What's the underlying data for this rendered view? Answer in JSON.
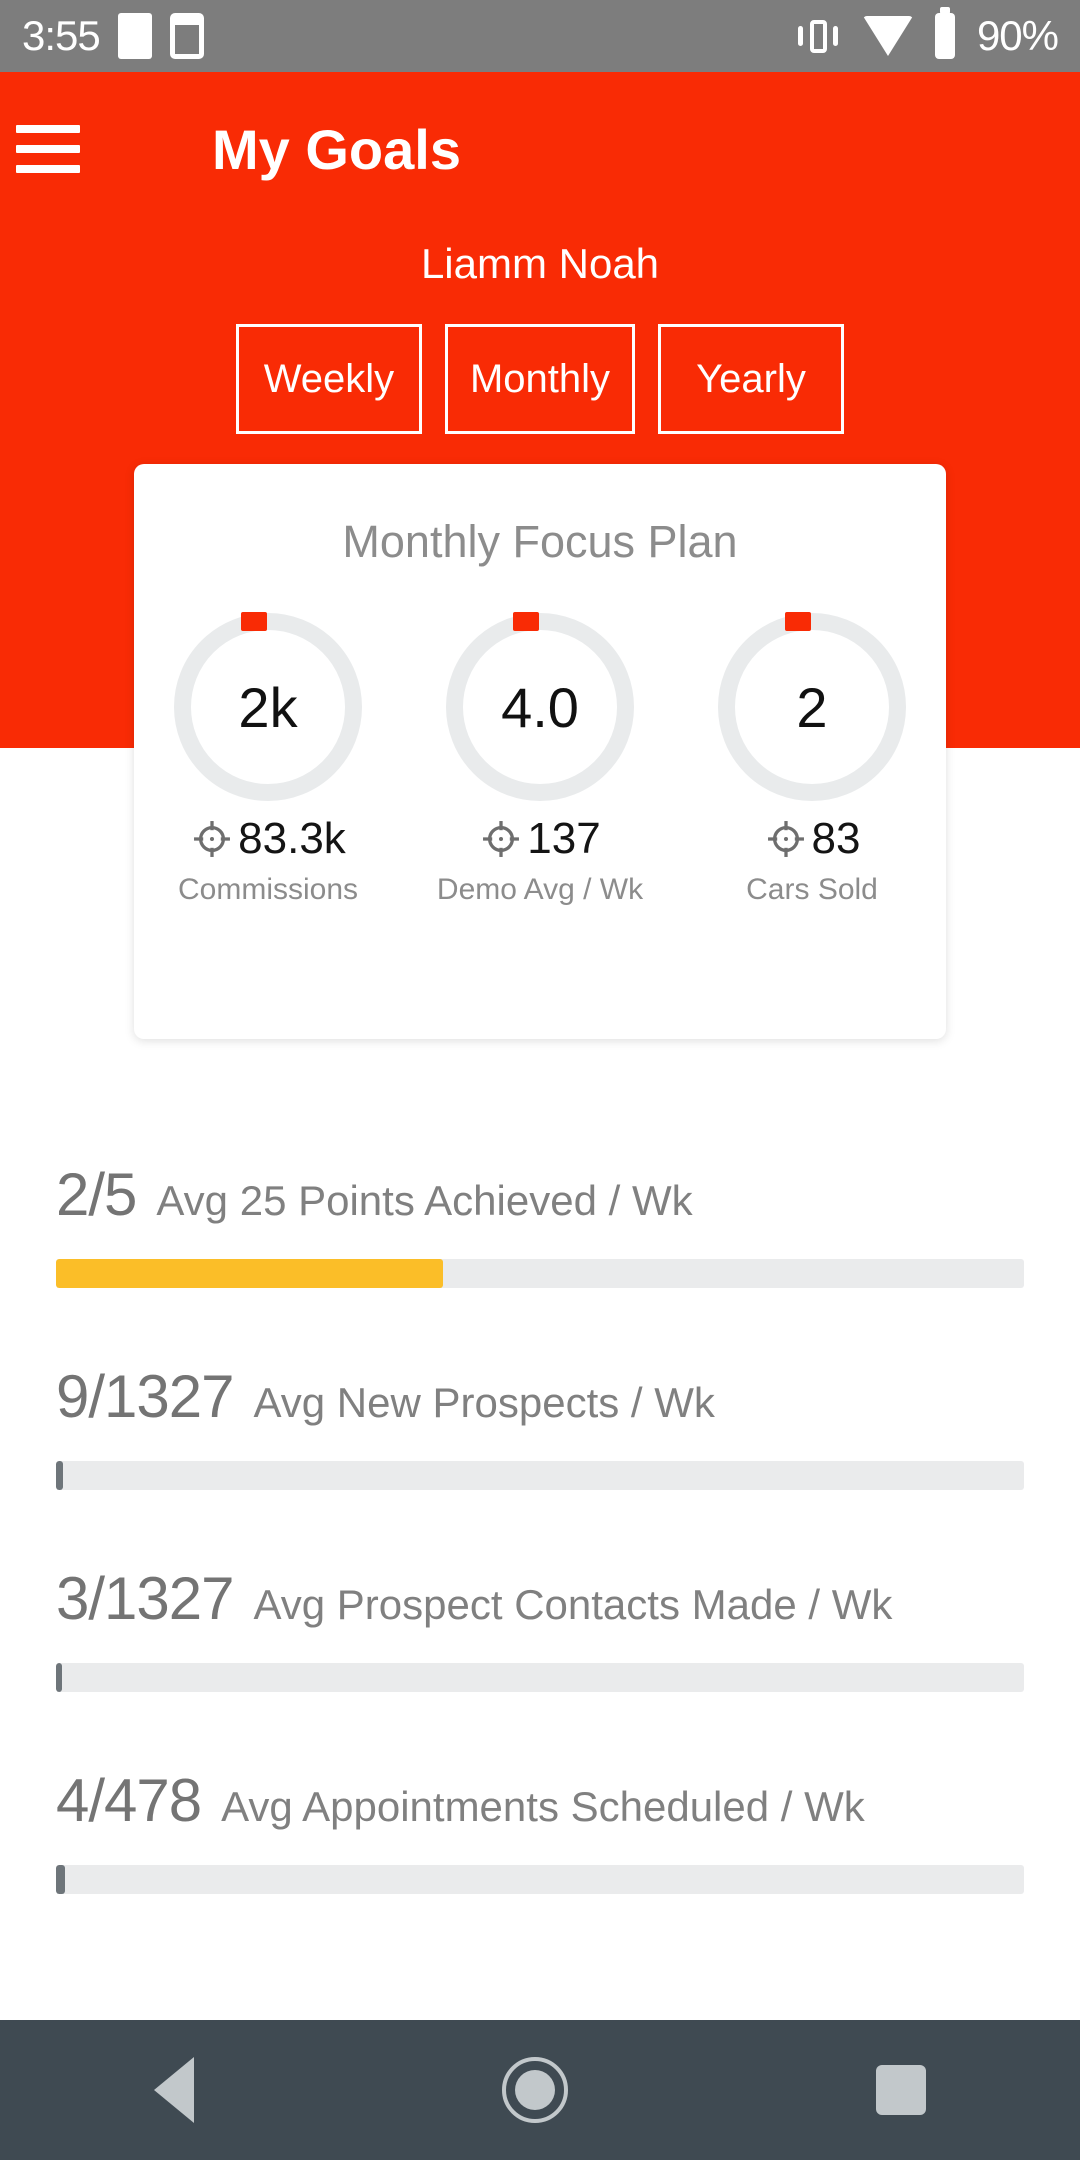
{
  "status_bar": {
    "time": "3:55",
    "battery_percent": "90%",
    "icons": [
      "square-icon",
      "calendar-icon",
      "vibrate-icon",
      "wifi-icon",
      "battery-icon"
    ]
  },
  "header": {
    "menu_icon": "hamburger-menu-icon",
    "title": "My Goals",
    "user_name": "Liamm Noah",
    "accent_color": "#f92b05"
  },
  "period_tabs": [
    {
      "label": "Weekly"
    },
    {
      "label": "Monthly"
    },
    {
      "label": "Yearly"
    }
  ],
  "focus_card": {
    "title": "Monthly Focus Plan",
    "gauges": [
      {
        "value": "2k",
        "target_icon": "target-icon",
        "target": "83.3k",
        "label": "Commissions"
      },
      {
        "value": "4.0",
        "target_icon": "target-icon",
        "target": "137",
        "label": "Demo Avg / Wk"
      },
      {
        "value": "2",
        "target_icon": "target-icon",
        "target": "83",
        "label": "Cars Sold"
      }
    ]
  },
  "goals": [
    {
      "fraction": "2/5",
      "label": "Avg 25 Points Achieved / Wk",
      "percent": 40,
      "fill_color": "#fbbe28"
    },
    {
      "fraction": "9/1327",
      "label": "Avg New Prospects / Wk",
      "percent": 0.7,
      "fill_color": "#6e757a"
    },
    {
      "fraction": "3/1327",
      "label": "Avg Prospect Contacts Made / Wk",
      "percent": 0.6,
      "fill_color": "#6e757a"
    },
    {
      "fraction": "4/478",
      "label": "Avg Appointments Scheduled / Wk",
      "percent": 0.9,
      "fill_color": "#6e757a"
    }
  ],
  "nav_bar": {
    "back_icon": "back-triangle-icon",
    "home_icon": "home-circle-icon",
    "recent_icon": "recent-apps-square-icon"
  }
}
